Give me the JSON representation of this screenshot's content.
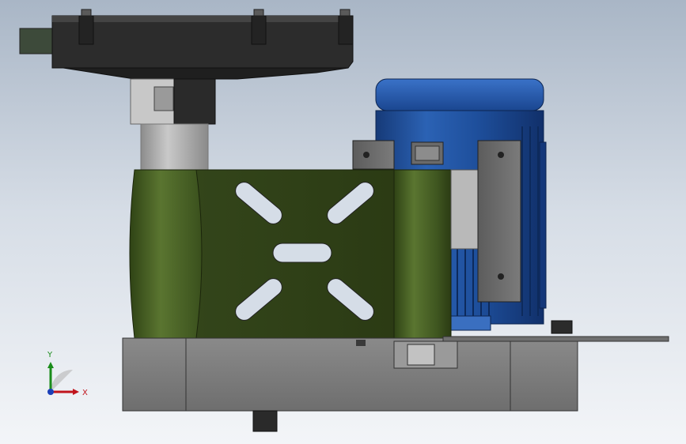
{
  "viewport": {
    "background": "gradient-light-blue-grey",
    "model": "motor-gearbox-assembly-side-view"
  },
  "colors": {
    "motor_blue": "#1f4e95",
    "housing_green": "#3b4d1f",
    "plate_dark": "#2b2b2b",
    "base_grey": "#7a7a7a",
    "shaft_grey": "#a7a7a7",
    "bracket_grey": "#6a6a6a",
    "triad_x": "#c0141c",
    "triad_y": "#1a8c1a",
    "triad_z": "#1b3fb8"
  },
  "triad": {
    "x_label": "X",
    "y_label": "Y"
  }
}
